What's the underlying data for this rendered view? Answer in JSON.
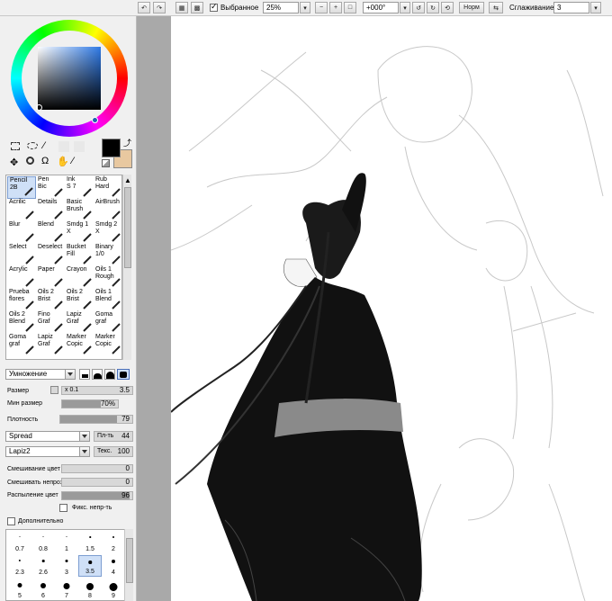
{
  "toolbar": {
    "selection_label": "Выбранное",
    "zoom": "25%",
    "rotation": "+000°",
    "mode_button": "Норм",
    "smoothing_label": "Сглаживание",
    "smoothing_value": "3"
  },
  "colors": {
    "primary": "#000000",
    "secondary": "#e8c8a0"
  },
  "tools": [
    "select-rect-icon",
    "lasso-icon",
    "magic-wand-icon",
    "move-icon",
    "zoom-icon",
    "rotate-icon",
    "hand-icon",
    "eyedropper-icon"
  ],
  "brushes": [
    {
      "l1": "Pencil",
      "l2": "2B"
    },
    {
      "l1": "Pen",
      "l2": "Bic"
    },
    {
      "l1": "Ink",
      "l2": "S 7"
    },
    {
      "l1": "Rub",
      "l2": "Hard"
    },
    {
      "l1": "Acrilic",
      "l2": ""
    },
    {
      "l1": "Details",
      "l2": ""
    },
    {
      "l1": "Basic",
      "l2": "Brush"
    },
    {
      "l1": "AirBrush",
      "l2": ""
    },
    {
      "l1": "Blur",
      "l2": ""
    },
    {
      "l1": "Blend",
      "l2": ""
    },
    {
      "l1": "Smdg 1",
      "l2": "X"
    },
    {
      "l1": "Smdg 2",
      "l2": "X"
    },
    {
      "l1": "Select",
      "l2": ""
    },
    {
      "l1": "Deselect",
      "l2": ""
    },
    {
      "l1": "Bucket",
      "l2": "Fill"
    },
    {
      "l1": "Binary",
      "l2": "1/0"
    },
    {
      "l1": "Acrylic",
      "l2": ""
    },
    {
      "l1": "Paper",
      "l2": ""
    },
    {
      "l1": "Crayon",
      "l2": ""
    },
    {
      "l1": "Oils 1",
      "l2": "Rough"
    },
    {
      "l1": "Prueba",
      "l2": "flores"
    },
    {
      "l1": "Oils 2",
      "l2": "Brist"
    },
    {
      "l1": "Oils 2",
      "l2": "Brist"
    },
    {
      "l1": "Oils 1",
      "l2": "Blend"
    },
    {
      "l1": "Oils 2",
      "l2": "Blend"
    },
    {
      "l1": "Fino",
      "l2": "Graf"
    },
    {
      "l1": "Lapiz",
      "l2": "Graf"
    },
    {
      "l1": "Goma",
      "l2": "graf"
    },
    {
      "l1": "Goma",
      "l2": "graf"
    },
    {
      "l1": "Lapiz",
      "l2": "Graf"
    },
    {
      "l1": "Marker",
      "l2": "Copic"
    },
    {
      "l1": "Marker",
      "l2": "Copic"
    }
  ],
  "blend_mode": "Умножение",
  "size": {
    "label": "Размер",
    "mult": "x 0.1",
    "value": "3.5"
  },
  "min_size": {
    "label": "Мин размер",
    "value": "70%",
    "fraction": 0.7
  },
  "density": {
    "label": "Плотность",
    "value": "79",
    "fraction": 0.79
  },
  "shape": {
    "value": "Spread",
    "amount_label": "Пл-ть",
    "amount": "44"
  },
  "texture": {
    "value": "Lapiz2",
    "label": "Текс.",
    "amount": "100"
  },
  "mix": {
    "label": "Смешивание цвет",
    "value": "0"
  },
  "dilute": {
    "label": "Смешивать непрозр",
    "value": "0"
  },
  "persistence": {
    "label": "Распыление цвет",
    "value": "96",
    "fraction": 0.96
  },
  "fix_opacity": "Фикс. непр-ть",
  "advanced": "Дополнительно",
  "sizes_row1": [
    "0.7",
    "0.8",
    "1",
    "1.5",
    "2"
  ],
  "sizes_row2": [
    "2.3",
    "2.6",
    "3",
    "3.5",
    "4"
  ],
  "sizes_row3": [
    "5",
    "6",
    "7",
    "8",
    "9"
  ]
}
